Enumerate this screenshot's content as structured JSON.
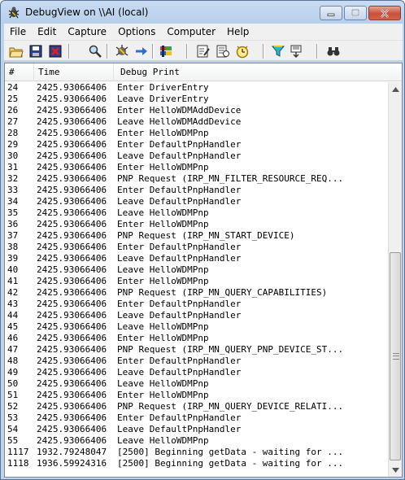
{
  "window": {
    "title": "DebugView on \\\\AI (local)"
  },
  "menu": [
    "File",
    "Edit",
    "Capture",
    "Options",
    "Computer",
    "Help"
  ],
  "toolbar": {
    "icons": [
      "open-icon",
      "save-icon",
      "clear-icon",
      "find-icon",
      "capture-icon",
      "autoscroll-icon",
      "capture-win32-icon",
      "properties-icon",
      "history-icon",
      "clock-icon",
      "filter-icon",
      "highlight-icon",
      "search-icon"
    ]
  },
  "list": {
    "columns": [
      "#",
      "Time",
      "Debug Print"
    ],
    "rows": [
      {
        "num": "24",
        "time": "2425.93066406",
        "msg": "Enter DriverEntry"
      },
      {
        "num": "25",
        "time": "2425.93066406",
        "msg": "Leave DriverEntry"
      },
      {
        "num": "26",
        "time": "2425.93066406",
        "msg": "Enter HelloWDMAddDevice"
      },
      {
        "num": "27",
        "time": "2425.93066406",
        "msg": "Leave HelloWDMAddDevice"
      },
      {
        "num": "28",
        "time": "2425.93066406",
        "msg": "Enter HelloWDMPnp"
      },
      {
        "num": "29",
        "time": "2425.93066406",
        "msg": "Enter DefaultPnpHandler"
      },
      {
        "num": "30",
        "time": "2425.93066406",
        "msg": "Leave DefaultPnpHandler"
      },
      {
        "num": "31",
        "time": "2425.93066406",
        "msg": "Enter HelloWDMPnp"
      },
      {
        "num": "32",
        "time": "2425.93066406",
        "msg": "PNP Request (IRP_MN_FILTER_RESOURCE_REQ..."
      },
      {
        "num": "33",
        "time": "2425.93066406",
        "msg": "Enter DefaultPnpHandler"
      },
      {
        "num": "34",
        "time": "2425.93066406",
        "msg": "Leave DefaultPnpHandler"
      },
      {
        "num": "35",
        "time": "2425.93066406",
        "msg": "Leave HelloWDMPnp"
      },
      {
        "num": "36",
        "time": "2425.93066406",
        "msg": "Enter HelloWDMPnp"
      },
      {
        "num": "37",
        "time": "2425.93066406",
        "msg": "PNP Request (IRP_MN_START_DEVICE)"
      },
      {
        "num": "38",
        "time": "2425.93066406",
        "msg": "Enter DefaultPnpHandler"
      },
      {
        "num": "39",
        "time": "2425.93066406",
        "msg": "Leave DefaultPnpHandler"
      },
      {
        "num": "40",
        "time": "2425.93066406",
        "msg": "Leave HelloWDMPnp"
      },
      {
        "num": "41",
        "time": "2425.93066406",
        "msg": "Enter HelloWDMPnp"
      },
      {
        "num": "42",
        "time": "2425.93066406",
        "msg": "PNP Request (IRP_MN_QUERY_CAPABILITIES)"
      },
      {
        "num": "43",
        "time": "2425.93066406",
        "msg": "Enter DefaultPnpHandler"
      },
      {
        "num": "44",
        "time": "2425.93066406",
        "msg": "Leave DefaultPnpHandler"
      },
      {
        "num": "45",
        "time": "2425.93066406",
        "msg": "Leave HelloWDMPnp"
      },
      {
        "num": "46",
        "time": "2425.93066406",
        "msg": "Enter HelloWDMPnp"
      },
      {
        "num": "47",
        "time": "2425.93066406",
        "msg": "PNP Request (IRP_MN_QUERY_PNP_DEVICE_ST..."
      },
      {
        "num": "48",
        "time": "2425.93066406",
        "msg": "Enter DefaultPnpHandler"
      },
      {
        "num": "49",
        "time": "2425.93066406",
        "msg": "Leave DefaultPnpHandler"
      },
      {
        "num": "50",
        "time": "2425.93066406",
        "msg": "Leave HelloWDMPnp"
      },
      {
        "num": "51",
        "time": "2425.93066406",
        "msg": "Enter HelloWDMPnp"
      },
      {
        "num": "52",
        "time": "2425.93066406",
        "msg": "PNP Request (IRP_MN_QUERY_DEVICE_RELATI..."
      },
      {
        "num": "53",
        "time": "2425.93066406",
        "msg": "Enter DefaultPnpHandler"
      },
      {
        "num": "54",
        "time": "2425.93066406",
        "msg": "Leave DefaultPnpHandler"
      },
      {
        "num": "55",
        "time": "2425.93066406",
        "msg": "Leave HelloWDMPnp"
      },
      {
        "num": "1117",
        "time": "1932.79248047",
        "msg": "[2500] Beginning getData - waiting for ..."
      },
      {
        "num": "1118",
        "time": "1936.59924316",
        "msg": "[2500] Beginning getData - waiting for ..."
      }
    ]
  }
}
